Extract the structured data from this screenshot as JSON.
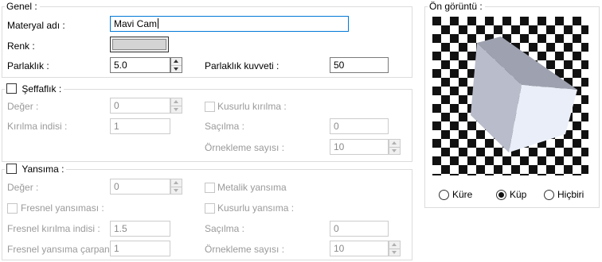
{
  "general": {
    "legend": "Genel :",
    "material_name_label": "Materyal adı :",
    "material_name_value": "Mavi Cam",
    "color_label": "Renk :",
    "color_value": "#d4d4d4",
    "brightness_label": "Parlaklık :",
    "brightness_value": "5.0",
    "brightness_strength_label": "Parlaklık kuvveti :",
    "brightness_strength_value": "50"
  },
  "transparency": {
    "legend": "Şeffaflık :",
    "enabled": false,
    "value_label": "Değer :",
    "value": "0",
    "refraction_index_label": "Kırılma indisi :",
    "refraction_index_value": "1",
    "imperfect_refraction_label": "Kusurlu kırılma :",
    "imperfect_refraction_checked": false,
    "scatter_label": "Saçılma :",
    "scatter_value": "0",
    "sample_count_label": "Örnekleme sayısı :",
    "sample_count_value": "10"
  },
  "reflection": {
    "legend": "Yansıma :",
    "enabled": false,
    "value_label": "Değer :",
    "value": "0",
    "metallic_label": "Metalik yansıma",
    "metallic_checked": false,
    "fresnel_label": "Fresnel yansıması :",
    "fresnel_checked": false,
    "imperfect_reflection_label": "Kusurlu yansıma :",
    "imperfect_reflection_checked": false,
    "fresnel_index_label": "Fresnel kırılma indisi :",
    "fresnel_index_value": "1.5",
    "scatter_label": "Saçılma :",
    "scatter_value": "0",
    "fresnel_multiplier_label": "Fresnel yansıma çarpanı :",
    "fresnel_multiplier_value": "1",
    "sample_count_label": "Örnekleme sayısı :",
    "sample_count_value": "10"
  },
  "preview": {
    "legend": "Ön görüntü :",
    "options": [
      {
        "label": "Küre",
        "selected": false
      },
      {
        "label": "Küp",
        "selected": true
      },
      {
        "label": "Hiçbiri",
        "selected": false
      }
    ]
  }
}
